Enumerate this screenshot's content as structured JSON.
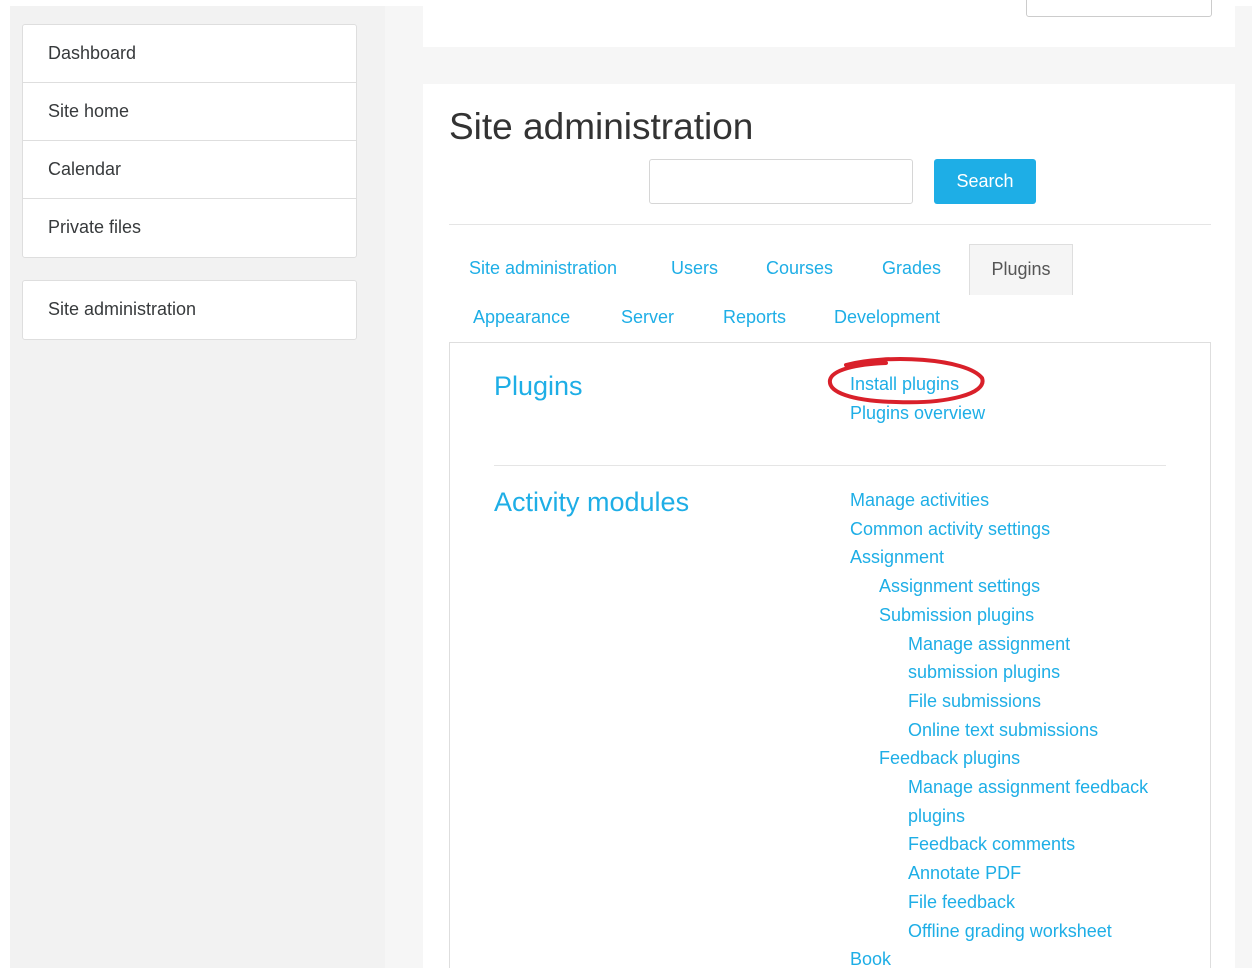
{
  "sidebar": {
    "nav_items": [
      {
        "label": "Dashboard"
      },
      {
        "label": "Site home"
      },
      {
        "label": "Calendar"
      },
      {
        "label": "Private files"
      }
    ],
    "admin_item": {
      "label": "Site administration"
    }
  },
  "main": {
    "title": "Site administration",
    "search": {
      "value": "",
      "placeholder": "",
      "button_label": "Search"
    },
    "tabs": [
      {
        "label": "Site administration"
      },
      {
        "label": "Users"
      },
      {
        "label": "Courses"
      },
      {
        "label": "Grades"
      },
      {
        "label": "Plugins",
        "active": true
      },
      {
        "label": "Appearance"
      },
      {
        "label": "Server"
      },
      {
        "label": "Reports"
      },
      {
        "label": "Development"
      }
    ],
    "sections": {
      "plugins": {
        "heading": "Plugins",
        "links": [
          "Install plugins",
          "Plugins overview"
        ]
      },
      "activity_modules": {
        "heading": "Activity modules",
        "links": [
          "Manage activities",
          "Common activity settings",
          "Assignment",
          "Assignment settings",
          "Submission plugins",
          "Manage assignment",
          "submission plugins",
          "File submissions",
          "Online text submissions",
          "Feedback plugins",
          "Manage assignment feedback",
          "plugins",
          "Feedback comments",
          "Annotate PDF",
          "File feedback",
          "Offline grading worksheet",
          "Book"
        ]
      }
    }
  },
  "colors": {
    "link": "#1eaee6",
    "button": "#1eaee6",
    "annotation": "#d9202a",
    "sidebar_bg": "#f2f2f2"
  }
}
